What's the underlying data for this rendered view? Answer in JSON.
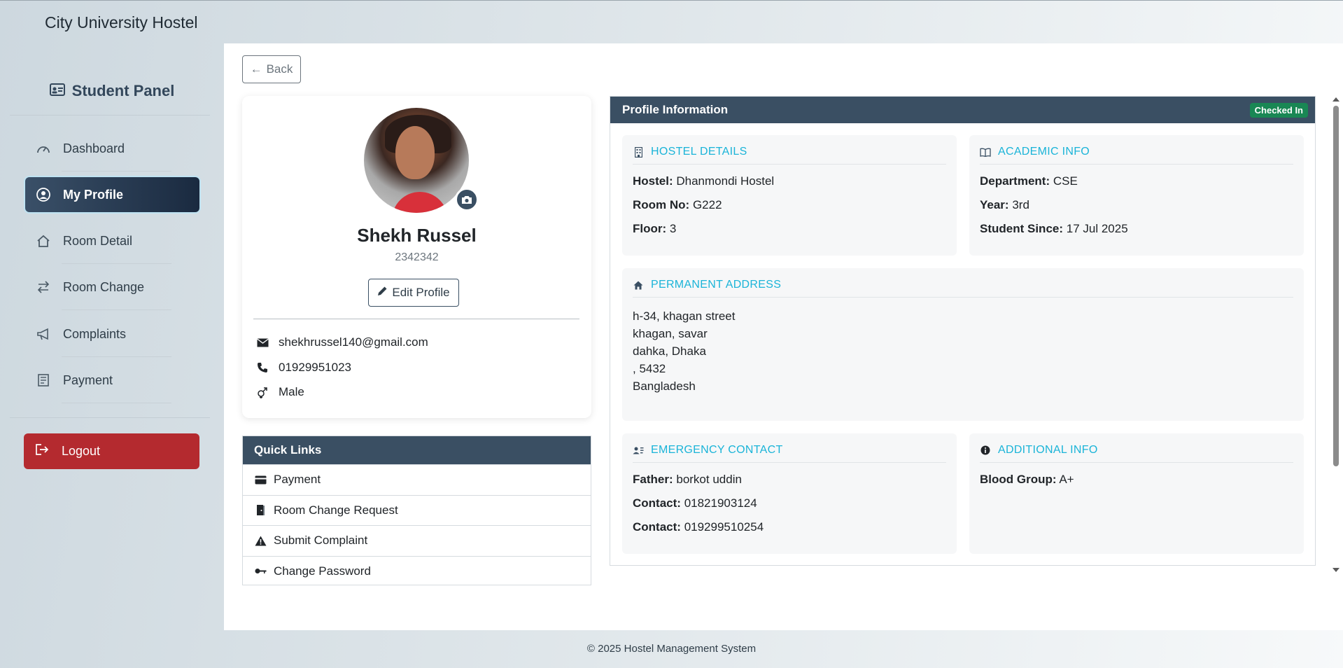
{
  "app": {
    "title": "City University Hostel"
  },
  "sidebar": {
    "panel_title": "Student Panel",
    "items": [
      {
        "label": "Dashboard",
        "icon": "gauge-icon",
        "active": false
      },
      {
        "label": "My Profile",
        "icon": "user-circle-icon",
        "active": true
      },
      {
        "label": "Room Detail",
        "icon": "house-icon",
        "active": false
      },
      {
        "label": "Room Change",
        "icon": "arrows-exchange-icon",
        "active": false
      },
      {
        "label": "Complaints",
        "icon": "megaphone-icon",
        "active": false
      },
      {
        "label": "Payment",
        "icon": "receipt-icon",
        "active": false
      }
    ],
    "logout_label": "Logout"
  },
  "main": {
    "back_label": "Back",
    "profile": {
      "name": "Shekh Russel",
      "id": "2342342",
      "edit_label": "Edit Profile",
      "email": "shekhrussel140@gmail.com",
      "phone": "01929951023",
      "gender": "Male"
    },
    "quick_links": {
      "title": "Quick Links",
      "items": [
        {
          "label": "Payment",
          "icon": "credit-card-icon"
        },
        {
          "label": "Room Change Request",
          "icon": "door-icon"
        },
        {
          "label": "Submit Complaint",
          "icon": "warning-icon"
        },
        {
          "label": "Change Password",
          "icon": "key-icon"
        }
      ]
    },
    "info": {
      "title": "Profile Information",
      "status_badge": "Checked In",
      "hostel": {
        "title": "Hostel Details",
        "hostel_label": "Hostel:",
        "hostel_value": "Dhanmondi Hostel",
        "room_label": "Room No:",
        "room_value": "G222",
        "floor_label": "Floor:",
        "floor_value": "3"
      },
      "academic": {
        "title": "Academic Info",
        "dept_label": "Department:",
        "dept_value": "CSE",
        "year_label": "Year:",
        "year_value": "3rd",
        "since_label": "Student Since:",
        "since_value": "17 Jul 2025"
      },
      "address": {
        "title": "Permanent Address",
        "lines": [
          "h-34, khagan street",
          "khagan, savar",
          "dahka, Dhaka",
          ", 5432",
          "Bangladesh"
        ]
      },
      "emergency": {
        "title": "Emergency Contact",
        "father_label": "Father:",
        "father_value": "borkot uddin",
        "contact1_label": "Contact:",
        "contact1_value": "01821903124",
        "contact2_label": "Contact:",
        "contact2_value": "019299510254"
      },
      "additional": {
        "title": "Additional Info",
        "blood_label": "Blood Group:",
        "blood_value": "A+"
      }
    }
  },
  "footer": {
    "text": "© 2025 Hostel Management System"
  },
  "colors": {
    "primary": "#3a4f63",
    "danger": "#b42a2f",
    "success": "#198754",
    "accent": "#1ab4d8"
  }
}
